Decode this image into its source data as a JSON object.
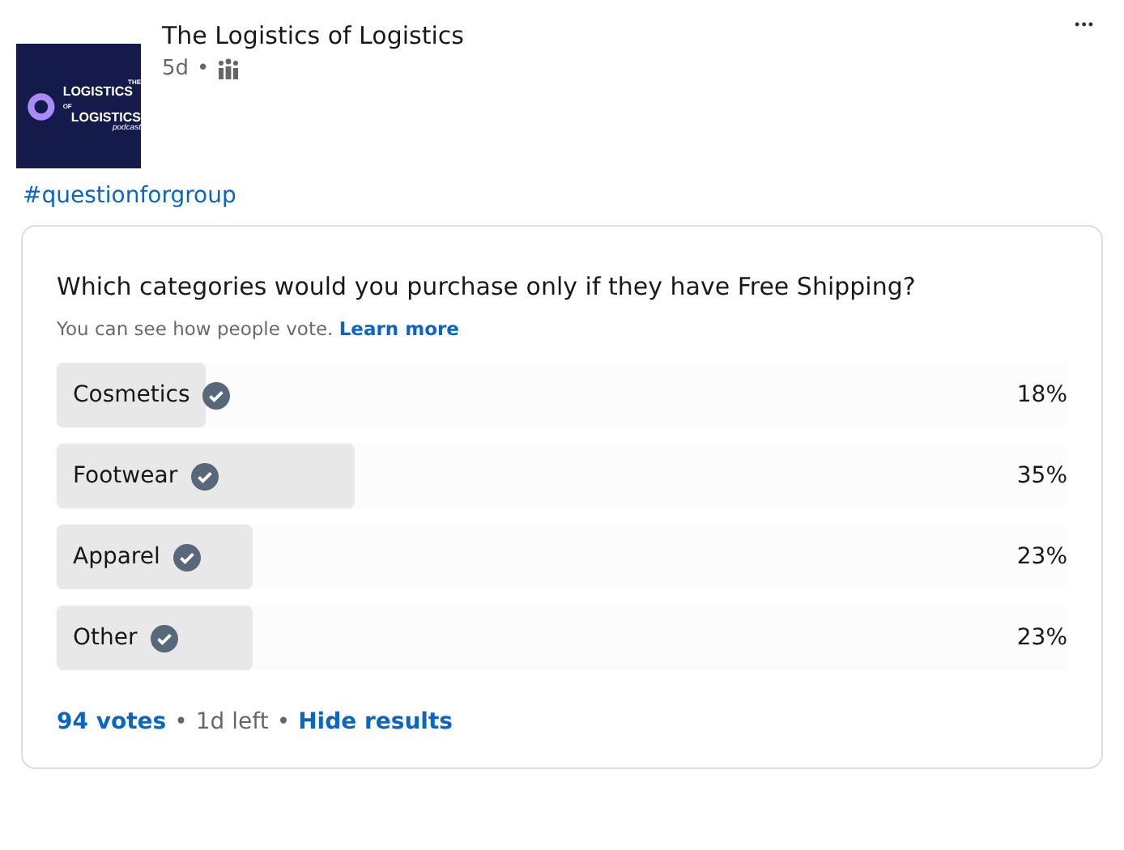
{
  "author": {
    "name": "The Logistics of Logistics",
    "age": "5d",
    "separator": "•",
    "logo": {
      "top": "THE",
      "line1": "LOGISTICS",
      "of": "OF",
      "line2": "LOGISTICS",
      "sub": "podcast"
    }
  },
  "more": "•••",
  "hashtag": "#questionforgroup",
  "poll": {
    "question": "Which categories would you purchase only if they have Free Shipping?",
    "note": "You can see how people vote.",
    "learn_more": "Learn more",
    "options": [
      {
        "label": "Cosmetics",
        "percent": "18%",
        "level": 0.148
      },
      {
        "label": "Footwear",
        "percent": "35%",
        "level": 0.295
      },
      {
        "label": "Apparel",
        "percent": "23%",
        "level": 0.194
      },
      {
        "label": "Other",
        "percent": "23%",
        "level": 0.194
      }
    ],
    "votes": "94 votes",
    "separator_1": "•",
    "time_left": "1d left",
    "separator_2": "•",
    "hide": "Hide results"
  }
}
